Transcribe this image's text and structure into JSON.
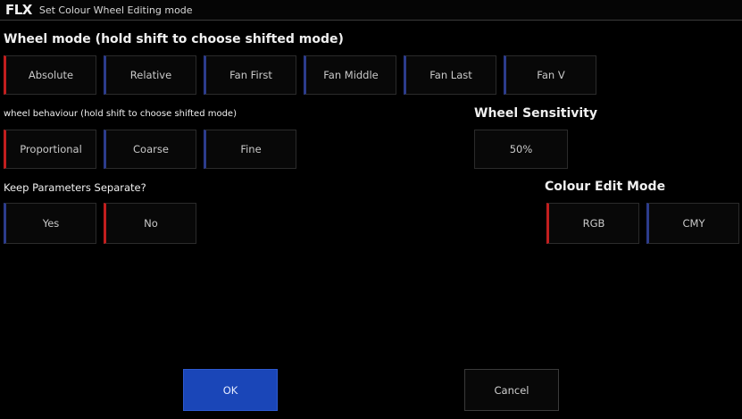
{
  "titlebar": {
    "logo": "FLX",
    "title": "Set Colour Wheel Editing mode"
  },
  "wheel_mode": {
    "heading": "Wheel mode (hold shift to choose shifted mode)",
    "options": [
      "Absolute",
      "Relative",
      "Fan First",
      "Fan Middle",
      "Fan Last",
      "Fan V"
    ],
    "selected": "Absolute"
  },
  "wheel_behaviour": {
    "heading": "wheel behaviour (hold shift to choose shifted mode)",
    "options": [
      "Proportional",
      "Coarse",
      "Fine"
    ],
    "selected": "Proportional"
  },
  "wheel_sensitivity": {
    "heading": "Wheel Sensitivity",
    "value": "50%"
  },
  "keep_separate": {
    "heading": "Keep Parameters Separate?",
    "options": [
      "Yes",
      "No"
    ],
    "selected": "No"
  },
  "colour_edit_mode": {
    "heading": "Colour Edit Mode",
    "options": [
      "RGB",
      "CMY"
    ],
    "selected": "RGB"
  },
  "footer": {
    "ok_label": "OK",
    "cancel_label": "Cancel"
  },
  "colors": {
    "background": "#000000",
    "selected_indicator": "#c21e1e",
    "unselected_indicator": "#2c3c8c",
    "ok_button": "#1a46b8"
  }
}
